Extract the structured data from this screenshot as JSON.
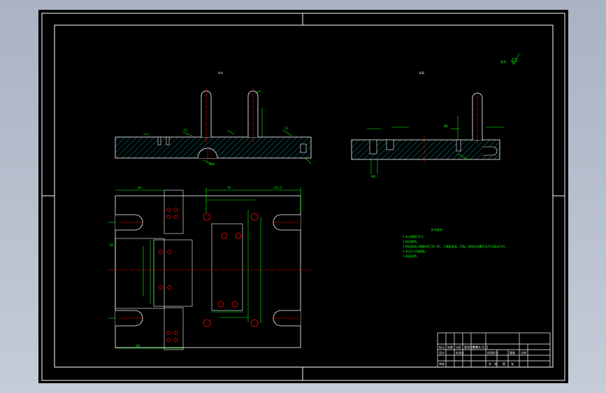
{
  "drawing": {
    "view_label_left": "A-A",
    "view_label_right": "B-B",
    "roughness_symbol": "其余",
    "notes_title": "技术要求",
    "notes": [
      "1.未注倒角C0.5。",
      "2.锐边倒钝。",
      "3.热处理淬火硬度HRC58~62，下模板表面、顶面、底面必须磨平及平行度≤0.02。",
      "4.未注尺寸按图纸。",
      "5.表面发黑。"
    ],
    "title_block": {
      "row1": [
        "标记",
        "处数",
        "分区",
        "更改文件号",
        "签名",
        "年.月.日"
      ],
      "row2": [
        "设计",
        "",
        "标准化",
        "",
        "阶段标记",
        "重量",
        "比例"
      ],
      "row3": [
        "审核",
        "",
        "",
        "",
        "共",
        "张",
        "第",
        "张"
      ]
    }
  },
  "colors": {
    "background": "#000000",
    "outline": "#ffffff",
    "dimension": "#00ff00",
    "centerline": "#ff0000",
    "hatch": "#00c8c8",
    "text": "#ffff00"
  }
}
